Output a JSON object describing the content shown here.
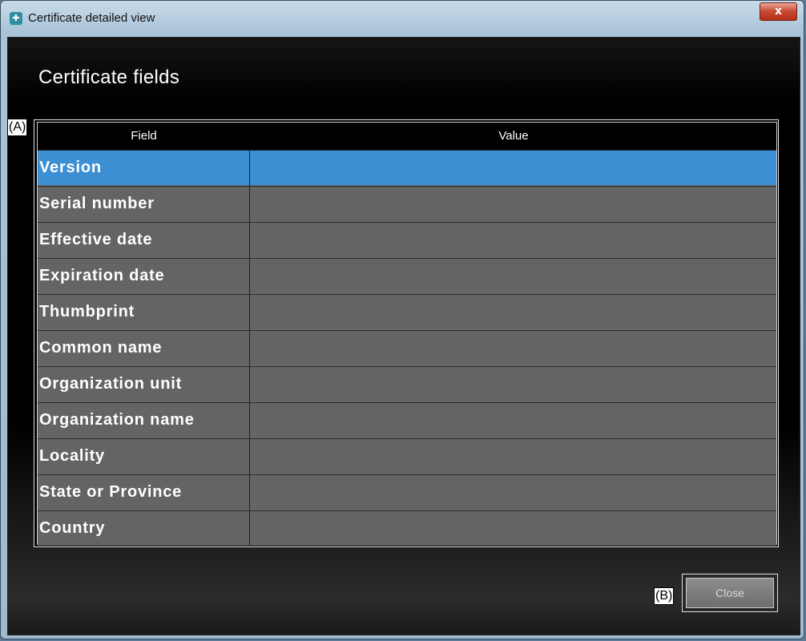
{
  "window": {
    "title": "Certificate detailed view",
    "close_glyph": "x",
    "icon": "certificate-icon"
  },
  "heading": "Certificate fields",
  "annotations": {
    "table": "(A)",
    "close": "(B)"
  },
  "table": {
    "columns": [
      "Field",
      "Value"
    ],
    "rows": [
      {
        "field": "Version",
        "value": "",
        "selected": true
      },
      {
        "field": "Serial number",
        "value": ""
      },
      {
        "field": "Effective date",
        "value": ""
      },
      {
        "field": "Expiration date",
        "value": ""
      },
      {
        "field": "Thumbprint",
        "value": ""
      },
      {
        "field": "Common name",
        "value": ""
      },
      {
        "field": "Organization unit",
        "value": ""
      },
      {
        "field": "Organization name",
        "value": ""
      },
      {
        "field": "Locality",
        "value": ""
      },
      {
        "field": "State or Province",
        "value": ""
      },
      {
        "field": "Country",
        "value": ""
      }
    ]
  },
  "buttons": {
    "close_label": "Close"
  },
  "colors": {
    "selection": "#3d8fd3",
    "row_bg": "#646464",
    "header_bg": "#000000"
  }
}
